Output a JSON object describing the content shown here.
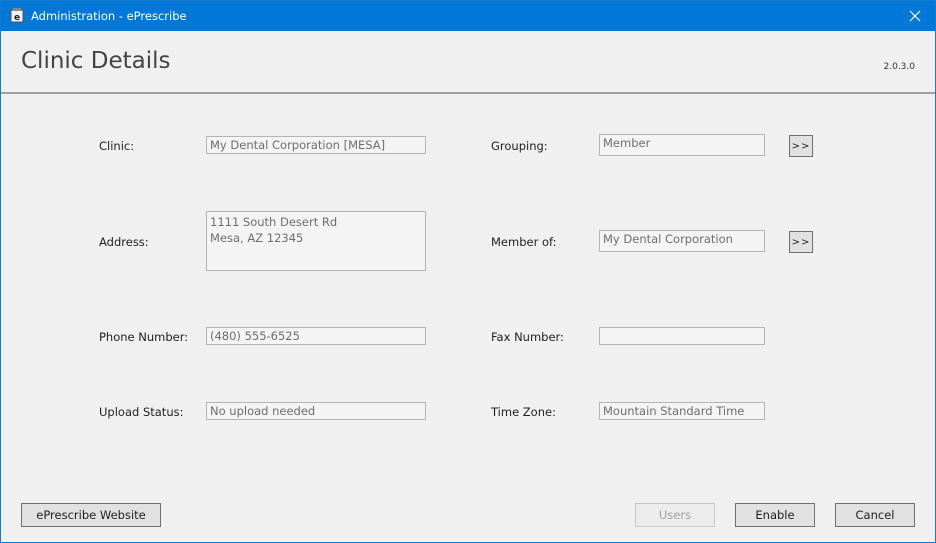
{
  "window": {
    "title": "Administration - ePrescribe",
    "close_glyph": "✕"
  },
  "header": {
    "title": "Clinic Details",
    "version": "2.0.3.0"
  },
  "form": {
    "clinic": {
      "label": "Clinic:",
      "value": "My Dental Corporation [MESA]"
    },
    "address": {
      "label": "Address:",
      "value": "1111 South Desert Rd\nMesa, AZ 12345"
    },
    "phone": {
      "label": "Phone Number:",
      "value": "(480) 555-6525"
    },
    "upload_status": {
      "label": "Upload Status:",
      "value": "No upload needed"
    },
    "grouping": {
      "label": "Grouping:",
      "value": "Member",
      "button": ">>"
    },
    "member_of": {
      "label": "Member of:",
      "value": "My Dental Corporation",
      "button": ">>"
    },
    "fax": {
      "label": "Fax Number:",
      "value": ""
    },
    "time_zone": {
      "label": "Time Zone:",
      "value": "Mountain Standard Time"
    }
  },
  "footer": {
    "website_button": "ePrescribe Website",
    "users_button": "Users",
    "enable_button": "Enable",
    "cancel_button": "Cancel"
  },
  "colors": {
    "titlebar": "#0078d7",
    "background": "#f0f0f0"
  },
  "icons": {
    "app": "eprescribe-app-icon",
    "close": "close-icon"
  }
}
